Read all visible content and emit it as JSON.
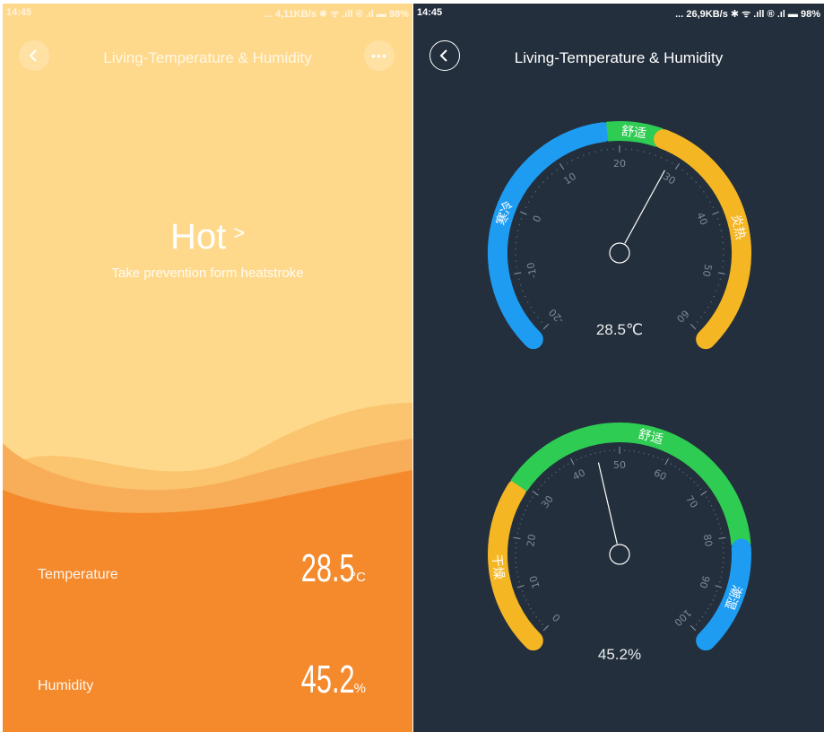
{
  "left": {
    "status_bar": {
      "time": "14:45",
      "right_text": "... 4,11KB/s ✱ ᯤ .ıll ® .ıl ▬ 98%"
    },
    "title": "Living-Temperature & Humidity",
    "status_word": "Hot",
    "advice": "Take prevention form heatstroke",
    "readings": [
      {
        "label": "Temperature",
        "value": "28.5",
        "unit": "°C"
      },
      {
        "label": "Humidity",
        "value": "45.2",
        "unit": "%"
      }
    ],
    "colors": {
      "top": "#ffd98b",
      "bottom": "#f48a2c"
    }
  },
  "right": {
    "status_bar": {
      "time": "14:45",
      "right_text": "... 26,9KB/s ✱ ᯤ .ıll ® .ıl ▬ 98%"
    },
    "title": "Living-Temperature & Humidity",
    "gauges": [
      {
        "id": "temperature",
        "min": -20,
        "max": 60,
        "value": 28.5,
        "readout": "28.5℃",
        "ticks": [
          "-20",
          "-10",
          "0",
          "10",
          "20",
          "30",
          "40",
          "50",
          "60"
        ],
        "zones": [
          {
            "from": -20,
            "to": 18,
            "color": "#1d9cf2",
            "label": "寒冷"
          },
          {
            "from": 18,
            "to": 26,
            "color": "#2ecc52",
            "label": "舒适"
          },
          {
            "from": 26,
            "to": 60,
            "color": "#f5b624",
            "label": "炎热"
          }
        ]
      },
      {
        "id": "humidity",
        "min": 0,
        "max": 100,
        "value": 45.2,
        "readout": "45.2%",
        "ticks": [
          "0",
          "10",
          "20",
          "30",
          "40",
          "50",
          "60",
          "70",
          "80",
          "90",
          "100"
        ],
        "zones": [
          {
            "from": 0,
            "to": 29,
            "color": "#f5b624",
            "label": "干燥"
          },
          {
            "from": 29,
            "to": 82,
            "color": "#2ecc52",
            "label": "舒适"
          },
          {
            "from": 82,
            "to": 100,
            "color": "#1d9cf2",
            "label": "潮湿"
          }
        ]
      }
    ]
  },
  "icons": {
    "back": "chevron-left-icon",
    "more": "more-dots-icon"
  }
}
